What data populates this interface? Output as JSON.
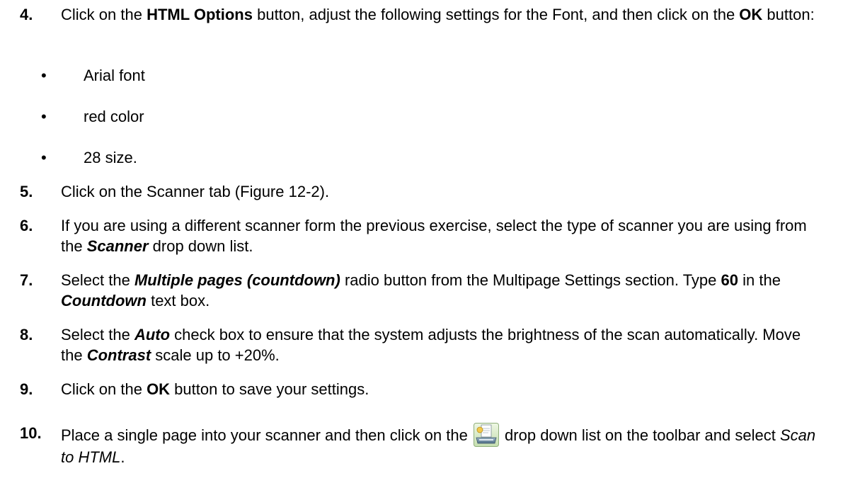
{
  "steps": [
    {
      "num": "4.",
      "parts": [
        {
          "t": "Click on the ",
          "s": ""
        },
        {
          "t": "HTML Options",
          "s": "b"
        },
        {
          "t": " button, adjust the following settings for the Font, and then click on the ",
          "s": ""
        },
        {
          "t": "OK",
          "s": "b"
        },
        {
          "t": " button:",
          "s": ""
        }
      ],
      "bullets": [
        "Arial font",
        "red color",
        "28 size."
      ]
    },
    {
      "num": "5.",
      "parts": [
        {
          "t": "Click on the Scanner tab (Figure 12-2).",
          "s": ""
        }
      ]
    },
    {
      "num": "6.",
      "parts": [
        {
          "t": "If you are using a different scanner form the previous exercise, select the type of scanner you are using from the ",
          "s": ""
        },
        {
          "t": "Scanner",
          "s": "bi"
        },
        {
          "t": " drop down list.",
          "s": ""
        }
      ]
    },
    {
      "num": "7.",
      "parts": [
        {
          "t": "Select the ",
          "s": ""
        },
        {
          "t": "Multiple pages (countdown)",
          "s": "bi"
        },
        {
          "t": " radio button from the Multipage Settings section. Type ",
          "s": ""
        },
        {
          "t": "60",
          "s": "b"
        },
        {
          "t": " in the ",
          "s": ""
        },
        {
          "t": "Countdown",
          "s": "bi"
        },
        {
          "t": " text box.",
          "s": ""
        }
      ]
    },
    {
      "num": "8.",
      "parts": [
        {
          "t": "Select the ",
          "s": ""
        },
        {
          "t": "Auto",
          "s": "bi"
        },
        {
          "t": " check box to ensure that the system adjusts the brightness of the scan automatically. Move the ",
          "s": ""
        },
        {
          "t": "Contrast",
          "s": "bi"
        },
        {
          "t": " scale up to +20%.",
          "s": ""
        }
      ]
    },
    {
      "num": "9.",
      "parts": [
        {
          "t": "Click on the ",
          "s": ""
        },
        {
          "t": "OK",
          "s": "b"
        },
        {
          "t": " button to save your settings.",
          "s": ""
        }
      ]
    },
    {
      "num": "10.",
      "parts": [
        {
          "t": "Place a single page into your scanner and then click on the ",
          "s": ""
        },
        {
          "icon": "scan-to-html-icon"
        },
        {
          "t": " drop down list on the toolbar and select ",
          "s": ""
        },
        {
          "t": "Scan to HTML",
          "s": "i"
        },
        {
          "t": ".",
          "s": ""
        }
      ]
    }
  ]
}
